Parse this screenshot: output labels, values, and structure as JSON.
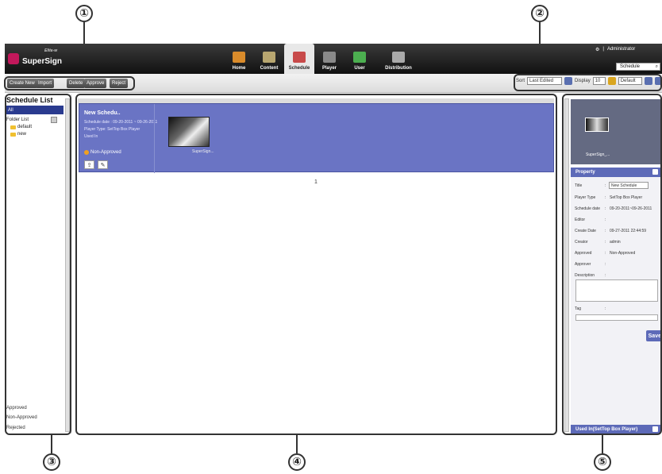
{
  "callouts": [
    "①",
    "②",
    "③",
    "④",
    "⑤"
  ],
  "app": {
    "logo_text": "SuperSign",
    "logo_sub": "Elite-w"
  },
  "nav": {
    "items": [
      {
        "label": "Home"
      },
      {
        "label": "Content"
      },
      {
        "label": "Schedule"
      },
      {
        "label": "Player"
      },
      {
        "label": "User"
      },
      {
        "label": "Distribution"
      }
    ],
    "active_label": "Schedule"
  },
  "topright": {
    "separator": "|",
    "user": "Administrator",
    "search_value": "Schedule",
    "search_icon": "magnifier-icon"
  },
  "toolbar": {
    "create_new": "Create New",
    "import": "Import",
    "delete": "Delete",
    "approve": "Approve",
    "reject": "Reject",
    "sort_label": "Sort",
    "sort_value": "Last Edited",
    "display_label": "Display",
    "display_value": "10",
    "view_value": "Default"
  },
  "left": {
    "title": "Schedule List",
    "all_label": "All",
    "folder_list": "Folder List",
    "folders": [
      "default",
      "new"
    ],
    "bottom": [
      "Approved",
      "Non-Approved",
      "Rejected"
    ]
  },
  "card": {
    "title": "New Schedu..",
    "schedule_date": "Schedule date : 09-20-2011 ~ 09-26-2011",
    "player_type": "Player Type: SetTop Box Player",
    "used_in": "Used In",
    "status": "Non-Approved",
    "thumb_caption": "SuperSign..."
  },
  "pagination": {
    "page": "1"
  },
  "right": {
    "thumb_caption": "SuperSign_...",
    "property_title": "Property",
    "props": [
      {
        "k": "Title",
        "v": ""
      },
      {
        "k": "Player Type",
        "v": "SetTop Box Player"
      },
      {
        "k": "Schedule date",
        "v": "09-20-2011~09-26-2011"
      },
      {
        "k": "Editor",
        "v": ""
      },
      {
        "k": "Create Date",
        "v": "09-27-2011 22:44:59"
      },
      {
        "k": "Creator",
        "v": "admin"
      },
      {
        "k": "Approved",
        "v": "Non-Approved"
      },
      {
        "k": "Approver",
        "v": ""
      },
      {
        "k": "Description",
        "v": ""
      }
    ],
    "title_value": "New Schedule",
    "tag_label": "Tag",
    "colon": ":",
    "save": "Save",
    "used_in_title": "Used In(SetTop Box Player)"
  },
  "colors": {
    "accent": "#5d6ab8",
    "card": "#6a74c4",
    "selected": "#2a3b8f"
  }
}
